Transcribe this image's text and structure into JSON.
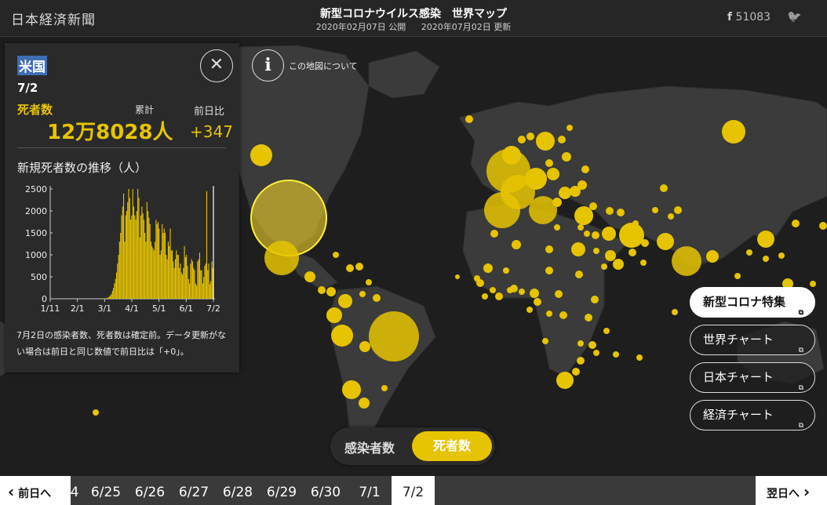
{
  "header": {
    "logo": "日本経済新聞",
    "title": "新型コロナウイルス感染　世界マップ",
    "published": "2020年02月07日 公開",
    "updated": "2020年07月02日 更新",
    "share_count": "51083",
    "facebook_icon": "f",
    "twitter_icon": "🐦"
  },
  "panel": {
    "country": "米国",
    "close_icon": "✕",
    "date": "7/2",
    "metric_label": "死者数",
    "cumulative_label": "累計",
    "prev_day_label": "前日比",
    "total": "12万8028人",
    "delta": "+347",
    "trend_title": "新規死者数の推移（人）",
    "note": "7月2日の感染者数、死者数は確定前。データ更新がない場合は前日と同じ数値で前日比は「+0」。"
  },
  "chart_data": {
    "type": "bar",
    "series": [
      {
        "values": [
          0,
          0,
          0,
          0,
          0,
          0,
          0,
          0,
          0,
          0,
          0,
          0,
          0,
          0,
          0,
          0,
          0,
          0,
          0,
          0,
          0,
          0,
          0,
          0,
          0,
          0,
          0,
          0,
          0,
          0,
          0,
          0,
          0,
          0,
          0,
          0,
          0,
          0,
          0,
          0,
          0,
          0,
          0,
          0,
          0,
          0,
          0,
          0,
          1,
          1,
          2,
          3,
          5,
          8,
          10,
          15,
          20,
          35,
          50,
          80,
          110,
          180,
          250,
          350,
          450,
          600,
          800,
          1000,
          1300,
          1500,
          1900,
          2100,
          2400,
          1300,
          1900,
          2000,
          2200,
          2500,
          2300,
          1800,
          1900,
          2500,
          2100,
          1900,
          1800,
          2000,
          2500,
          2300,
          1400,
          1900,
          2100,
          1950,
          1800,
          1500,
          1300,
          2200,
          2000,
          1850,
          1700,
          1300,
          1200,
          1150,
          1100,
          1300,
          1800,
          1700,
          1750,
          1600,
          1000,
          1100,
          1700,
          1500,
          1600,
          1500,
          1000,
          900,
          1300,
          1200,
          1600,
          1100,
          1100,
          850,
          700,
          900,
          1100,
          1000,
          1000,
          700,
          800,
          600,
          550,
          700,
          1200,
          950,
          1000,
          750,
          450,
          350,
          800,
          900,
          850,
          700,
          650,
          350,
          300,
          850,
          900,
          1050,
          650,
          650,
          350,
          500,
          750,
          800,
          2450,
          650,
          800,
          330,
          400,
          850,
          700
        ]
      }
    ],
    "x_tick_labels": [
      "1/11",
      "2/1",
      "3/1",
      "4/1",
      "5/1",
      "6/1",
      "7/2"
    ],
    "y_tick_labels": [
      "0",
      "500",
      "1000",
      "1500",
      "2000",
      "2500"
    ],
    "ylim": [
      0,
      2500
    ],
    "color": "#e6c400"
  },
  "map": {
    "info_icon": "i",
    "info_text": "この地図について"
  },
  "side_buttons": [
    {
      "label": "新型コロナ特集",
      "ext_icon": "⧉"
    },
    {
      "label": "世界チャート",
      "ext_icon": "⧉"
    },
    {
      "label": "日本チャート",
      "ext_icon": "⧉"
    },
    {
      "label": "経済チャート",
      "ext_icon": "⧉"
    }
  ],
  "toggle": {
    "infected": "感染者数",
    "deaths": "死者数"
  },
  "timeline": {
    "prev": "前日へ",
    "next": "翌日へ",
    "prev_icon": "‹",
    "next_icon": "›",
    "dates": [
      "4",
      "6/25",
      "6/26",
      "6/27",
      "6/28",
      "6/29",
      "6/30",
      "7/1",
      "7/2"
    ]
  },
  "colors": {
    "accent": "#e6c400",
    "selection": "#3e6db3"
  }
}
